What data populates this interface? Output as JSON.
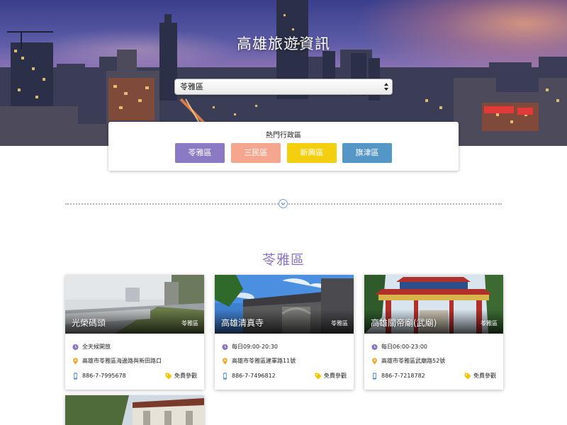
{
  "hero": {
    "title": "高雄旅遊資訊",
    "select_value": "苓雅區"
  },
  "hot": {
    "title": "熱門行政區",
    "districts": [
      {
        "label": "苓雅區",
        "color": "#8b7ac3"
      },
      {
        "label": "三民區",
        "color": "#f4a78e"
      },
      {
        "label": "新興區",
        "color": "#f4cf10"
      },
      {
        "label": "旗津區",
        "color": "#5497c6"
      }
    ]
  },
  "section": {
    "title": "苓雅區"
  },
  "spots": [
    {
      "name": "光榮碼頭",
      "zone": "苓雅區",
      "hours": "全天候開放",
      "address": "高雄市苓雅區海邊路與新田路口",
      "phone": "886-7-7995678",
      "ticket": "免費參觀"
    },
    {
      "name": "高雄清真寺",
      "zone": "苓雅區",
      "hours": "每日09:00-20:30",
      "address": "高雄市苓雅區建軍路11號",
      "phone": "886-7-7496812",
      "ticket": "免費參觀"
    },
    {
      "name": "高雄關帝廟(武廟)",
      "zone": "苓雅區",
      "hours": "每日06:00-23:00",
      "address": "高雄市苓雅區武廟路52號",
      "phone": "886-7-7218782",
      "ticket": "免費參觀"
    }
  ],
  "colors": {
    "accent": "#8b72c4",
    "clock_icon": "#8b72c4",
    "pin_icon": "#f5a623",
    "phone_icon": "#4a90d9",
    "tag_icon": "#f5c400"
  }
}
